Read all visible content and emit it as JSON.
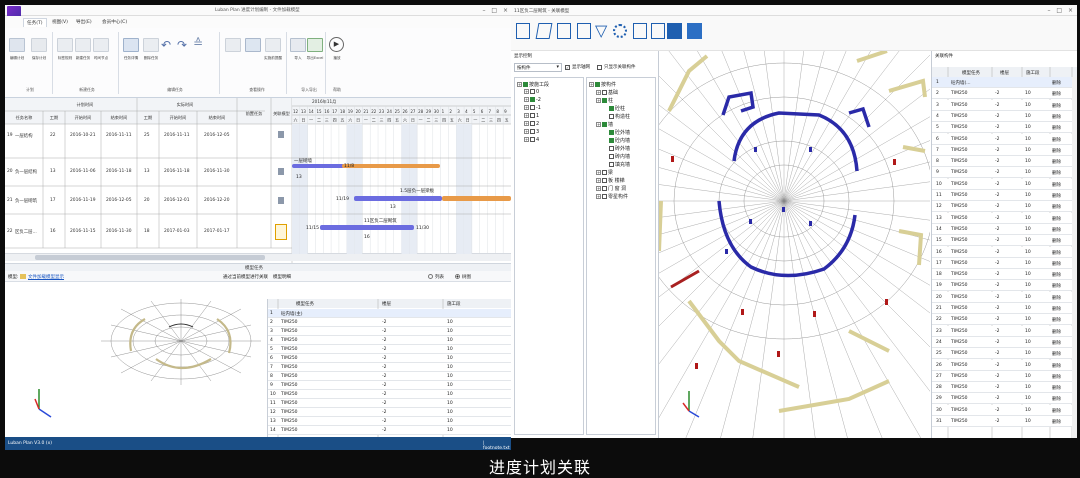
{
  "left_window": {
    "title": "Luban Plan 进度计划编制 - 文件加载模型",
    "tabs": [
      "任务(T)",
      "视图(V)",
      "导出(E)",
      "会员中心(C)"
    ],
    "ribbon": {
      "buttons": [
        {
          "label": "编辑计划"
        },
        {
          "label": "保存计划"
        },
        {
          "label": "标签规则"
        },
        {
          "label": "新建任务"
        },
        {
          "label": "时间节点"
        },
        {
          "label": "新增前置任务"
        },
        {
          "label": "任务详情"
        },
        {
          "label": "删除任务"
        },
        {
          "label": "撤销"
        },
        {
          "label": "升级"
        },
        {
          "label": "降级"
        },
        {
          "label": "整理项目"
        },
        {
          "label": "加载模型"
        },
        {
          "label": "实施前提醒"
        },
        {
          "label": "导入"
        },
        {
          "label": "导出Excel"
        },
        {
          "label": "导出"
        },
        {
          "label": "帮助"
        },
        {
          "label": "播放"
        }
      ],
      "groups": [
        "计划",
        "新建任务",
        "编辑任务",
        "查看操作",
        "导入导出",
        "帮助"
      ]
    },
    "grid": {
      "group_plan": "计划时间",
      "group_actual": "实际时间",
      "headers": [
        "任务名称",
        "工期",
        "开始时间",
        "结束时间",
        "工期",
        "开始时间",
        "结束时间",
        "前置任务",
        "关联模型"
      ],
      "rows": [
        {
          "id": "19",
          "name": "一层结构",
          "dur": "22",
          "start": "2016-10-21",
          "end": "2016-11-11",
          "adur": "25",
          "astart": "2016-11-11",
          "aend": "2016-12-05"
        },
        {
          "id": "20",
          "name": "负一层结构",
          "dur": "13",
          "start": "2016-11-06",
          "end": "2016-11-18",
          "adur": "13",
          "astart": "2016-11-18",
          "aend": "2016-11-30"
        },
        {
          "id": "21",
          "name": "负一层砌筑",
          "dur": "17",
          "start": "2016-11-19",
          "end": "2016-12-05",
          "adur": "20",
          "astart": "2016-12-01",
          "aend": "2016-12-20"
        },
        {
          "id": "22",
          "name": "区负二层...",
          "dur": "16",
          "start": "2016-11-15",
          "end": "2016-11-30",
          "adur": "18",
          "astart": "2017-01-03",
          "aend": "2017-01-17"
        }
      ]
    },
    "gantt": {
      "month": "2016年11月",
      "days": [
        "12",
        "13",
        "14",
        "15",
        "16",
        "17",
        "18",
        "19",
        "20",
        "21",
        "22",
        "23",
        "24",
        "25",
        "26",
        "27",
        "28",
        "29",
        "30",
        "1",
        "2",
        "3",
        "4",
        "5",
        "6",
        "7",
        "8",
        "9"
      ],
      "weekdays": [
        "六",
        "日",
        "一",
        "二",
        "三",
        "四",
        "五",
        "六",
        "日",
        "一",
        "二",
        "三",
        "四",
        "五",
        "六",
        "日",
        "一",
        "二",
        "三",
        "四",
        "五",
        "六",
        "日",
        "一",
        "二",
        "三",
        "四",
        "五"
      ],
      "labels": [
        "一层砌墙",
        "1.5层负一层梁板",
        "11区负二层砌筑"
      ],
      "dates": [
        "11/8",
        "11/19",
        "11/15",
        "11/30"
      ],
      "durations": [
        "13",
        "13",
        "16"
      ]
    },
    "bottom": {
      "section_title": "模型任务",
      "toolbar_left": "模型:",
      "link": "文件加载模型显示",
      "filter_label": "通过当前模型进行关联",
      "detail_label": "模型明细",
      "radio_list": "列表",
      "radio_tree": "树图",
      "table_headers": [
        "模型任务",
        "楼层",
        "施工段"
      ],
      "table_rows": [
        {
          "idx": "1",
          "task": "砼内墙(主)",
          "floor": "",
          "seg": ""
        },
        {
          "idx": "2",
          "task": "TIM250",
          "floor": "-2",
          "seg": "10"
        },
        {
          "idx": "3",
          "task": "TIM250",
          "floor": "-2",
          "seg": "10"
        },
        {
          "idx": "4",
          "task": "TIM250",
          "floor": "-2",
          "seg": "10"
        },
        {
          "idx": "5",
          "task": "TIM250",
          "floor": "-2",
          "seg": "10"
        },
        {
          "idx": "6",
          "task": "TIM250",
          "floor": "-2",
          "seg": "10"
        },
        {
          "idx": "7",
          "task": "TIM250",
          "floor": "-2",
          "seg": "10"
        },
        {
          "idx": "8",
          "task": "TIM250",
          "floor": "-2",
          "seg": "10"
        },
        {
          "idx": "9",
          "task": "TIM250",
          "floor": "-2",
          "seg": "10"
        },
        {
          "idx": "10",
          "task": "TIM250",
          "floor": "-2",
          "seg": "10"
        },
        {
          "idx": "11",
          "task": "TIM250",
          "floor": "-2",
          "seg": "10"
        },
        {
          "idx": "12",
          "task": "TIM250",
          "floor": "-2",
          "seg": "10"
        },
        {
          "idx": "13",
          "task": "TIM250",
          "floor": "-2",
          "seg": "10"
        },
        {
          "idx": "14",
          "task": "TIM250",
          "floor": "-2",
          "seg": "10"
        }
      ]
    },
    "status": {
      "left": "Luban Plan V3.0 (x)",
      "right": "| footnote.txt"
    }
  },
  "right_window": {
    "title": "11区负二层砌筑 - 关联模型",
    "panel_label": "显示控制",
    "dropdown": "按构件",
    "check_show_axis": "显示轴网",
    "check_show_related": "只显示关联构件",
    "tree_left": [
      {
        "label": "按施工段",
        "level": 0
      },
      {
        "label": "0",
        "level": 1
      },
      {
        "label": "-2",
        "level": 1
      },
      {
        "label": "-1",
        "level": 1
      },
      {
        "label": "1",
        "level": 1
      },
      {
        "label": "2",
        "level": 1
      },
      {
        "label": "3",
        "level": 1
      },
      {
        "label": "4",
        "level": 1
      }
    ],
    "tree_right": [
      {
        "label": "按构件",
        "level": 0
      },
      {
        "label": "基础",
        "level": 1
      },
      {
        "label": "柱",
        "level": 1
      },
      {
        "label": "砼柱",
        "level": 2
      },
      {
        "label": "构造柱",
        "level": 2
      },
      {
        "label": "墙",
        "level": 1
      },
      {
        "label": "砼外墙",
        "level": 2
      },
      {
        "label": "砼内墙",
        "level": 2
      },
      {
        "label": "砖外墙",
        "level": 2
      },
      {
        "label": "砖内墙",
        "level": 2
      },
      {
        "label": "填充墙",
        "level": 2
      },
      {
        "label": "梁",
        "level": 1
      },
      {
        "label": "板 楼梯",
        "level": 1
      },
      {
        "label": "门 窗 洞",
        "level": 1
      },
      {
        "label": "零星构件",
        "level": 1
      }
    ],
    "table_title": "关联构件",
    "table_headers": [
      "模型任务",
      "楼层",
      "施工段"
    ],
    "rows": [
      {
        "idx": "1",
        "task": "砼内墙(...",
        "floor": "",
        "seg": "",
        "op": "删除"
      },
      {
        "idx": "2",
        "task": "TIM250",
        "floor": "-2",
        "seg": "10",
        "op": "删除"
      },
      {
        "idx": "3",
        "task": "TIM250",
        "floor": "-2",
        "seg": "10",
        "op": "删除"
      },
      {
        "idx": "4",
        "task": "TIM250",
        "floor": "-2",
        "seg": "10",
        "op": "删除"
      },
      {
        "idx": "5",
        "task": "TIM250",
        "floor": "-2",
        "seg": "10",
        "op": "删除"
      },
      {
        "idx": "6",
        "task": "TIM250",
        "floor": "-2",
        "seg": "10",
        "op": "删除"
      },
      {
        "idx": "7",
        "task": "TIM250",
        "floor": "-2",
        "seg": "10",
        "op": "删除"
      },
      {
        "idx": "8",
        "task": "TIM250",
        "floor": "-2",
        "seg": "10",
        "op": "删除"
      },
      {
        "idx": "9",
        "task": "TIM250",
        "floor": "-2",
        "seg": "10",
        "op": "删除"
      },
      {
        "idx": "10",
        "task": "TIM250",
        "floor": "-2",
        "seg": "10",
        "op": "删除"
      },
      {
        "idx": "11",
        "task": "TIM250",
        "floor": "-2",
        "seg": "10",
        "op": "删除"
      },
      {
        "idx": "12",
        "task": "TIM250",
        "floor": "-2",
        "seg": "10",
        "op": "删除"
      },
      {
        "idx": "13",
        "task": "TIM250",
        "floor": "-2",
        "seg": "10",
        "op": "删除"
      },
      {
        "idx": "14",
        "task": "TIM250",
        "floor": "-2",
        "seg": "10",
        "op": "删除"
      },
      {
        "idx": "15",
        "task": "TIM250",
        "floor": "-2",
        "seg": "10",
        "op": "删除"
      },
      {
        "idx": "16",
        "task": "TIM250",
        "floor": "-2",
        "seg": "10",
        "op": "删除"
      },
      {
        "idx": "17",
        "task": "TIM250",
        "floor": "-2",
        "seg": "10",
        "op": "删除"
      },
      {
        "idx": "18",
        "task": "TIM250",
        "floor": "-2",
        "seg": "10",
        "op": "删除"
      },
      {
        "idx": "19",
        "task": "TIM250",
        "floor": "-2",
        "seg": "10",
        "op": "删除"
      },
      {
        "idx": "20",
        "task": "TIM250",
        "floor": "-2",
        "seg": "10",
        "op": "删除"
      },
      {
        "idx": "21",
        "task": "TIM250",
        "floor": "-2",
        "seg": "10",
        "op": "删除"
      },
      {
        "idx": "22",
        "task": "TIM250",
        "floor": "-2",
        "seg": "10",
        "op": "删除"
      },
      {
        "idx": "23",
        "task": "TIM250",
        "floor": "-2",
        "seg": "10",
        "op": "删除"
      },
      {
        "idx": "24",
        "task": "TIM250",
        "floor": "-2",
        "seg": "10",
        "op": "删除"
      },
      {
        "idx": "25",
        "task": "TIM250",
        "floor": "-2",
        "seg": "10",
        "op": "删除"
      },
      {
        "idx": "26",
        "task": "TIM250",
        "floor": "-2",
        "seg": "10",
        "op": "删除"
      },
      {
        "idx": "27",
        "task": "TIM250",
        "floor": "-2",
        "seg": "10",
        "op": "删除"
      },
      {
        "idx": "28",
        "task": "TIM250",
        "floor": "-2",
        "seg": "10",
        "op": "删除"
      },
      {
        "idx": "29",
        "task": "TIM250",
        "floor": "-2",
        "seg": "10",
        "op": "删除"
      },
      {
        "idx": "30",
        "task": "TIM250",
        "floor": "-2",
        "seg": "10",
        "op": "删除"
      },
      {
        "idx": "31",
        "task": "TIM250",
        "floor": "-2",
        "seg": "10",
        "op": "删除"
      }
    ]
  },
  "caption": "进度计划关联",
  "colors": {
    "accent": "#1a4e86",
    "bar_plan": "#6b6ce0",
    "bar_actual": "#e89a48",
    "wall_blue": "#2a2aa8",
    "wall_yellow": "#d8cf96"
  }
}
